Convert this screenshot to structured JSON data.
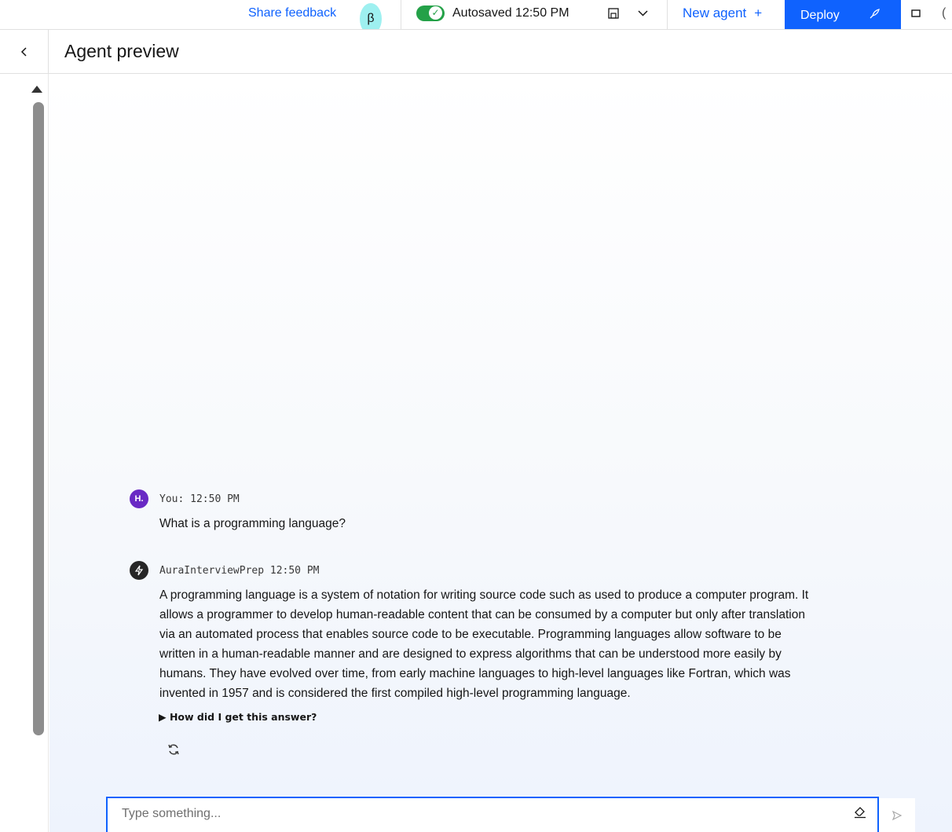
{
  "toolbar": {
    "share_feedback": "Share feedback",
    "beta_badge": "β",
    "autosave_text": "Autosaved 12:50 PM",
    "save_icon": "save-icon",
    "new_agent": "New agent",
    "new_agent_plus": "+",
    "deploy": "Deploy"
  },
  "header": {
    "back_glyph": "<",
    "title": "Agent preview"
  },
  "messages": [
    {
      "avatar": "H.",
      "meta": "You: 12:50 PM",
      "text": "What is a programming language?"
    },
    {
      "avatar": "bolt",
      "meta": "AuraInterviewPrep 12:50 PM",
      "lines": [
        "A programming language is a system of notation for writing source code such as used to produce a computer program. It",
        "allows a programmer to develop human-readable content that can be consumed by a computer but only after translation",
        "via an automated process that enables source code to be executable. Programming languages allow software to be",
        "written in a human-readable manner and are designed to express algorithms that can be understood more easily by",
        "humans. They have evolved over time, from early machine languages to high-level languages like Fortran, which was",
        "invented in 1957 and is considered the first compiled high-level programming language."
      ]
    }
  ],
  "explain": "How did I get this answer?",
  "input": {
    "placeholder": "Type something...",
    "value": ""
  },
  "colors": {
    "accent": "#0f62fe",
    "user_avatar": "#6929c4",
    "autosave_toggle": "#24a148"
  }
}
